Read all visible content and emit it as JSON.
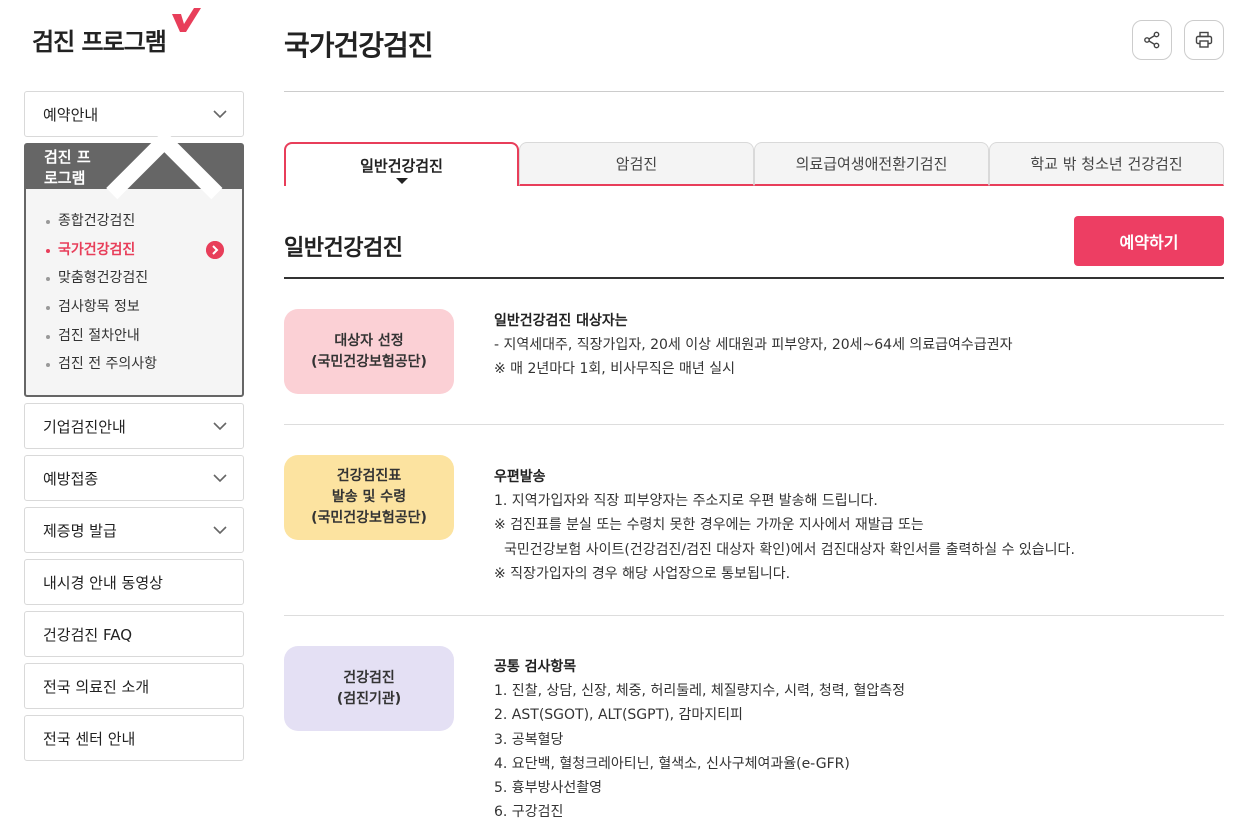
{
  "brand": {
    "title": "검진 프로그램",
    "check_color": "#e83e5a"
  },
  "sidebar": {
    "items_top": [
      {
        "label": "예약안내"
      }
    ],
    "open_group": {
      "label": "검진 프로그램",
      "children": [
        {
          "label": "종합건강검진"
        },
        {
          "label": "국가건강검진",
          "active": true
        },
        {
          "label": "맞춤형건강검진"
        },
        {
          "label": "검사항목 정보"
        },
        {
          "label": "검진 절차안내"
        },
        {
          "label": "검진 전 주의사항"
        }
      ]
    },
    "items_bottom": [
      {
        "label": "기업검진안내",
        "has_chevron": true
      },
      {
        "label": "예방접종",
        "has_chevron": true
      },
      {
        "label": "제증명 발급",
        "has_chevron": true
      },
      {
        "label": "내시경 안내 동영상",
        "has_chevron": false
      },
      {
        "label": "건강검진 FAQ",
        "has_chevron": false
      },
      {
        "label": "전국 의료진 소개",
        "has_chevron": false
      },
      {
        "label": "전국 센터 안내",
        "has_chevron": false
      }
    ]
  },
  "header": {
    "title": "국가건강검진",
    "icons": [
      "share-icon",
      "print-icon"
    ]
  },
  "tabs": [
    {
      "label": "일반건강검진",
      "active": true
    },
    {
      "label": "암검진",
      "active": false
    },
    {
      "label": "의료급여생애전환기검진",
      "active": false
    },
    {
      "label": "학교 밖 청소년 건강검진",
      "active": false
    }
  ],
  "section": {
    "title": "일반건강검진",
    "reserve_label": "예약하기",
    "accent": "#ed3e63"
  },
  "rows": [
    {
      "pill_lines": [
        "대상자 선정",
        "(국민건강보험공단)"
      ],
      "pill_color": "#fbd0d5",
      "heading": "일반건강검진 대상자는",
      "lines": [
        "- 지역세대주, 직장가입자, 20세 이상 세대원과 피부양자, 20세~64세 의료급여수급권자",
        "※ 매 2년마다 1회, 비사무직은 매년 실시"
      ]
    },
    {
      "pill_lines": [
        "건강검진표",
        "발송 및 수령",
        "(국민건강보험공단)"
      ],
      "pill_color": "#fce3a0",
      "heading": "우편발송",
      "lines": [
        "1. 지역가입자와 직장 피부양자는 주소지로 우편 발송해 드립니다.",
        "※ 검진표를 분실 또는 수령치 못한 경우에는 가까운 지사에서 재발급 또는",
        "국민건강보험 사이트(건강검진/검진 대상자 확인)에서 검진대상자 확인서를 출력하실 수 있습니다.",
        "※ 직장가입자의 경우 해당 사업장으로 통보됩니다."
      ]
    },
    {
      "pill_lines": [
        "건강검진",
        "(검진기관)"
      ],
      "pill_color": "#e4e0f4",
      "heading": "공통 검사항목",
      "lines": [
        "1. 진찰, 상담, 신장, 체중, 허리둘레, 체질량지수, 시력, 청력, 혈압측정",
        "2. AST(SGOT), ALT(SGPT), 감마지티피",
        "3. 공복혈당",
        "4. 요단백, 혈청크레아티닌, 혈색소, 신사구체여과율(e-GFR)",
        "5. 흉부방사선촬영",
        "6. 구강검진"
      ]
    }
  ]
}
